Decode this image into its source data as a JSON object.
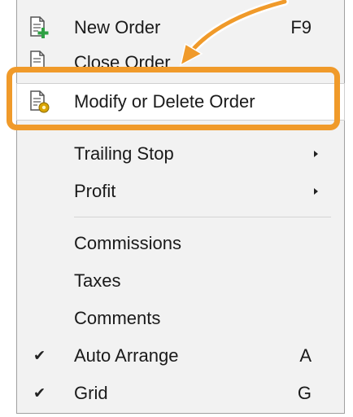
{
  "menu": {
    "items": [
      {
        "label": "New Order",
        "shortcut": "F9",
        "icon": "new-order-icon"
      },
      {
        "label": "Close Order",
        "shortcut": "",
        "icon": "close-order-icon"
      },
      {
        "label": "Modify or Delete Order",
        "shortcut": "",
        "icon": "modify-order-icon"
      },
      {
        "label": "Trailing Stop",
        "submenu": true
      },
      {
        "label": "Profit",
        "submenu": true
      },
      {
        "label": "Commissions"
      },
      {
        "label": "Taxes"
      },
      {
        "label": "Comments"
      },
      {
        "label": "Auto Arrange",
        "shortcut": "A",
        "checked": true
      },
      {
        "label": "Grid",
        "shortcut": "G",
        "checked": true
      }
    ],
    "check_glyph": "✔"
  },
  "colors": {
    "highlight_orange": "#f09a2a",
    "menu_background": "#f2f2f2",
    "selected_background": "#ffffff",
    "icon_green_plus": "#2ea043",
    "icon_gold_gear": "#d9a400"
  }
}
